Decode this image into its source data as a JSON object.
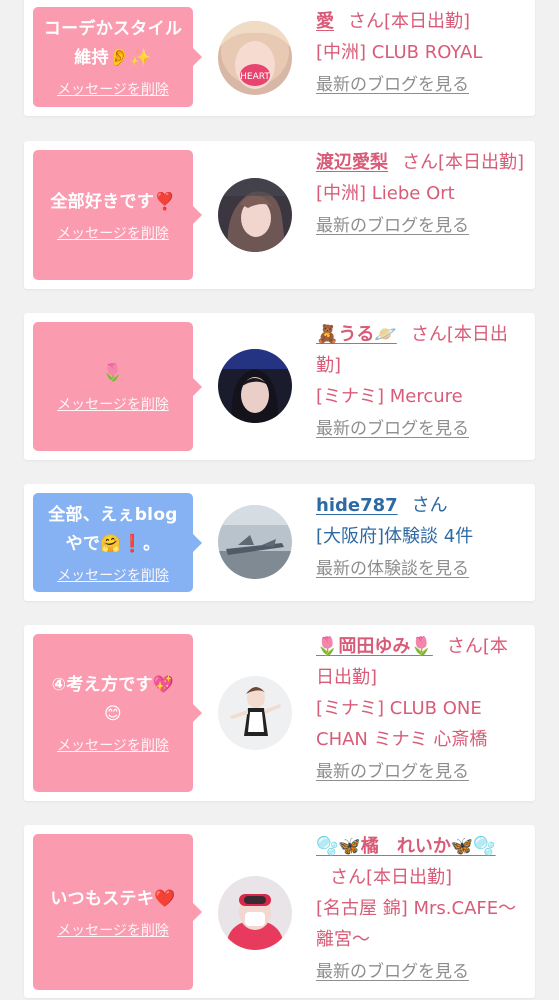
{
  "delete_label": "メッセージを削除",
  "colors": {
    "pink_bubble": "#fb9bb0",
    "blue_bubble": "#86b2f3",
    "pink_text": "#d85c78",
    "blue_text": "#2d6aa3",
    "link_gray": "#8e8e8e",
    "background": "#f1f1f1"
  },
  "cards": [
    {
      "message": "コーデかスタイル維持👂✨",
      "name": "愛",
      "suffix": "さん[本日出勤]",
      "shop": "[中洲] CLUB ROYAL",
      "link": "最新のブログを見る"
    },
    {
      "message": "全部好きです❣️",
      "name": "渡辺愛梨",
      "suffix": "さん[本日出勤]",
      "shop": "[中洲] Liebe Ort",
      "link": "最新のブログを見る"
    },
    {
      "message": "🌷",
      "name": "🧸うる🪐",
      "suffix": "さん[本日出勤]",
      "shop": "[ミナミ] Mercure",
      "link": "最新のブログを見る"
    },
    {
      "message": "全部、えぇblogやで🤗❗️。",
      "name": "hide787",
      "suffix": "さん",
      "shop": "[大阪府]体験談 4件",
      "link": "最新の体験談を見る"
    },
    {
      "message": "④考え方です💖😊",
      "name": "🌷岡田ゆみ🌷",
      "suffix": "さん[本日出勤]",
      "shop": "[ミナミ] CLUB ONE CHAN ミナミ 心斎橋",
      "link": "最新のブログを見る"
    },
    {
      "message": "いつもステキ❤️",
      "name": "🫧🦋橘　れいか🦋🫧",
      "suffix": "さん[本日出勤]",
      "shop": "[名古屋 錦] Mrs.CAFE〜離宮〜",
      "link": "最新のブログを見る"
    }
  ]
}
